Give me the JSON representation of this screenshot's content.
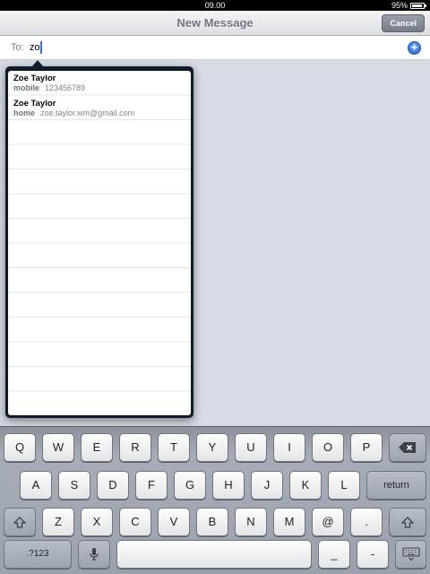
{
  "status": {
    "time": "09.00",
    "battery_pct": "95%",
    "battery_level": 0.95
  },
  "nav": {
    "title": "New Message",
    "cancel_label": "Cancel"
  },
  "to_field": {
    "label": "To:",
    "value": "zo",
    "add_icon": "plus-circle-icon"
  },
  "suggestions": [
    {
      "name": "Zoe Taylor",
      "type": "mobile",
      "value": "123456789"
    },
    {
      "name": "Zoe Taylor",
      "type": "home",
      "value": "zoe.taylor.wm@gmail.com"
    }
  ],
  "keyboard": {
    "row1": [
      "Q",
      "W",
      "E",
      "R",
      "T",
      "Y",
      "U",
      "I",
      "O",
      "P"
    ],
    "row2": [
      "A",
      "S",
      "D",
      "F",
      "G",
      "H",
      "J",
      "K",
      "L"
    ],
    "row3": [
      "Z",
      "X",
      "C",
      "V",
      "B",
      "N",
      "M",
      "@",
      "."
    ],
    "backspace_icon": "backspace-icon",
    "return_label": "return",
    "shift_icon": "shift-icon",
    "numbers_label": ".?123",
    "mic_icon": "microphone-icon",
    "underscore_label": "_",
    "dash_label": "-",
    "hide_keyboard_icon": "keyboard-hide-icon"
  }
}
